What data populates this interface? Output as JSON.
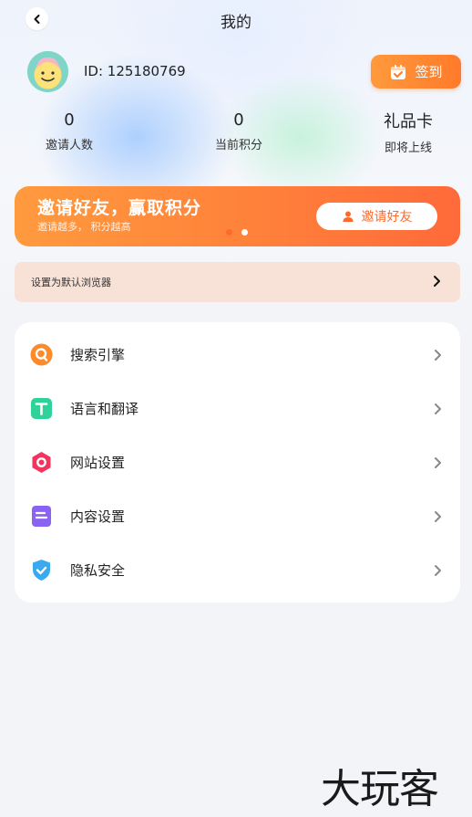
{
  "header": {
    "title": "我的"
  },
  "user": {
    "id_text": "ID: 125180769"
  },
  "checkin": {
    "label": "签到"
  },
  "stats": [
    {
      "value": "0",
      "label": "邀请人数"
    },
    {
      "value": "0",
      "label": "当前积分"
    },
    {
      "value": "礼品卡",
      "label": "即将上线"
    }
  ],
  "banner": {
    "title": "邀请好友，赢取积分",
    "subtitle": "邀请越多， 积分越高",
    "button_label": "邀请好友",
    "pages": 2,
    "active_page": 1
  },
  "default_browser": {
    "label": "设置为默认浏览器"
  },
  "menu": {
    "items": [
      {
        "label": "搜索引擎",
        "icon": "search-engine-icon"
      },
      {
        "label": "语言和翻译",
        "icon": "translate-icon"
      },
      {
        "label": "网站设置",
        "icon": "website-settings-icon"
      },
      {
        "label": "内容设置",
        "icon": "content-settings-icon"
      },
      {
        "label": "隐私安全",
        "icon": "privacy-shield-icon"
      }
    ]
  },
  "watermark": {
    "text": "大玩客"
  },
  "colors": {
    "accent": "#ff7a2a",
    "banner_bg": "#ff8a3c",
    "default_browser_bg": "#f8e1d6",
    "page_bg": "#f3f4f8"
  }
}
